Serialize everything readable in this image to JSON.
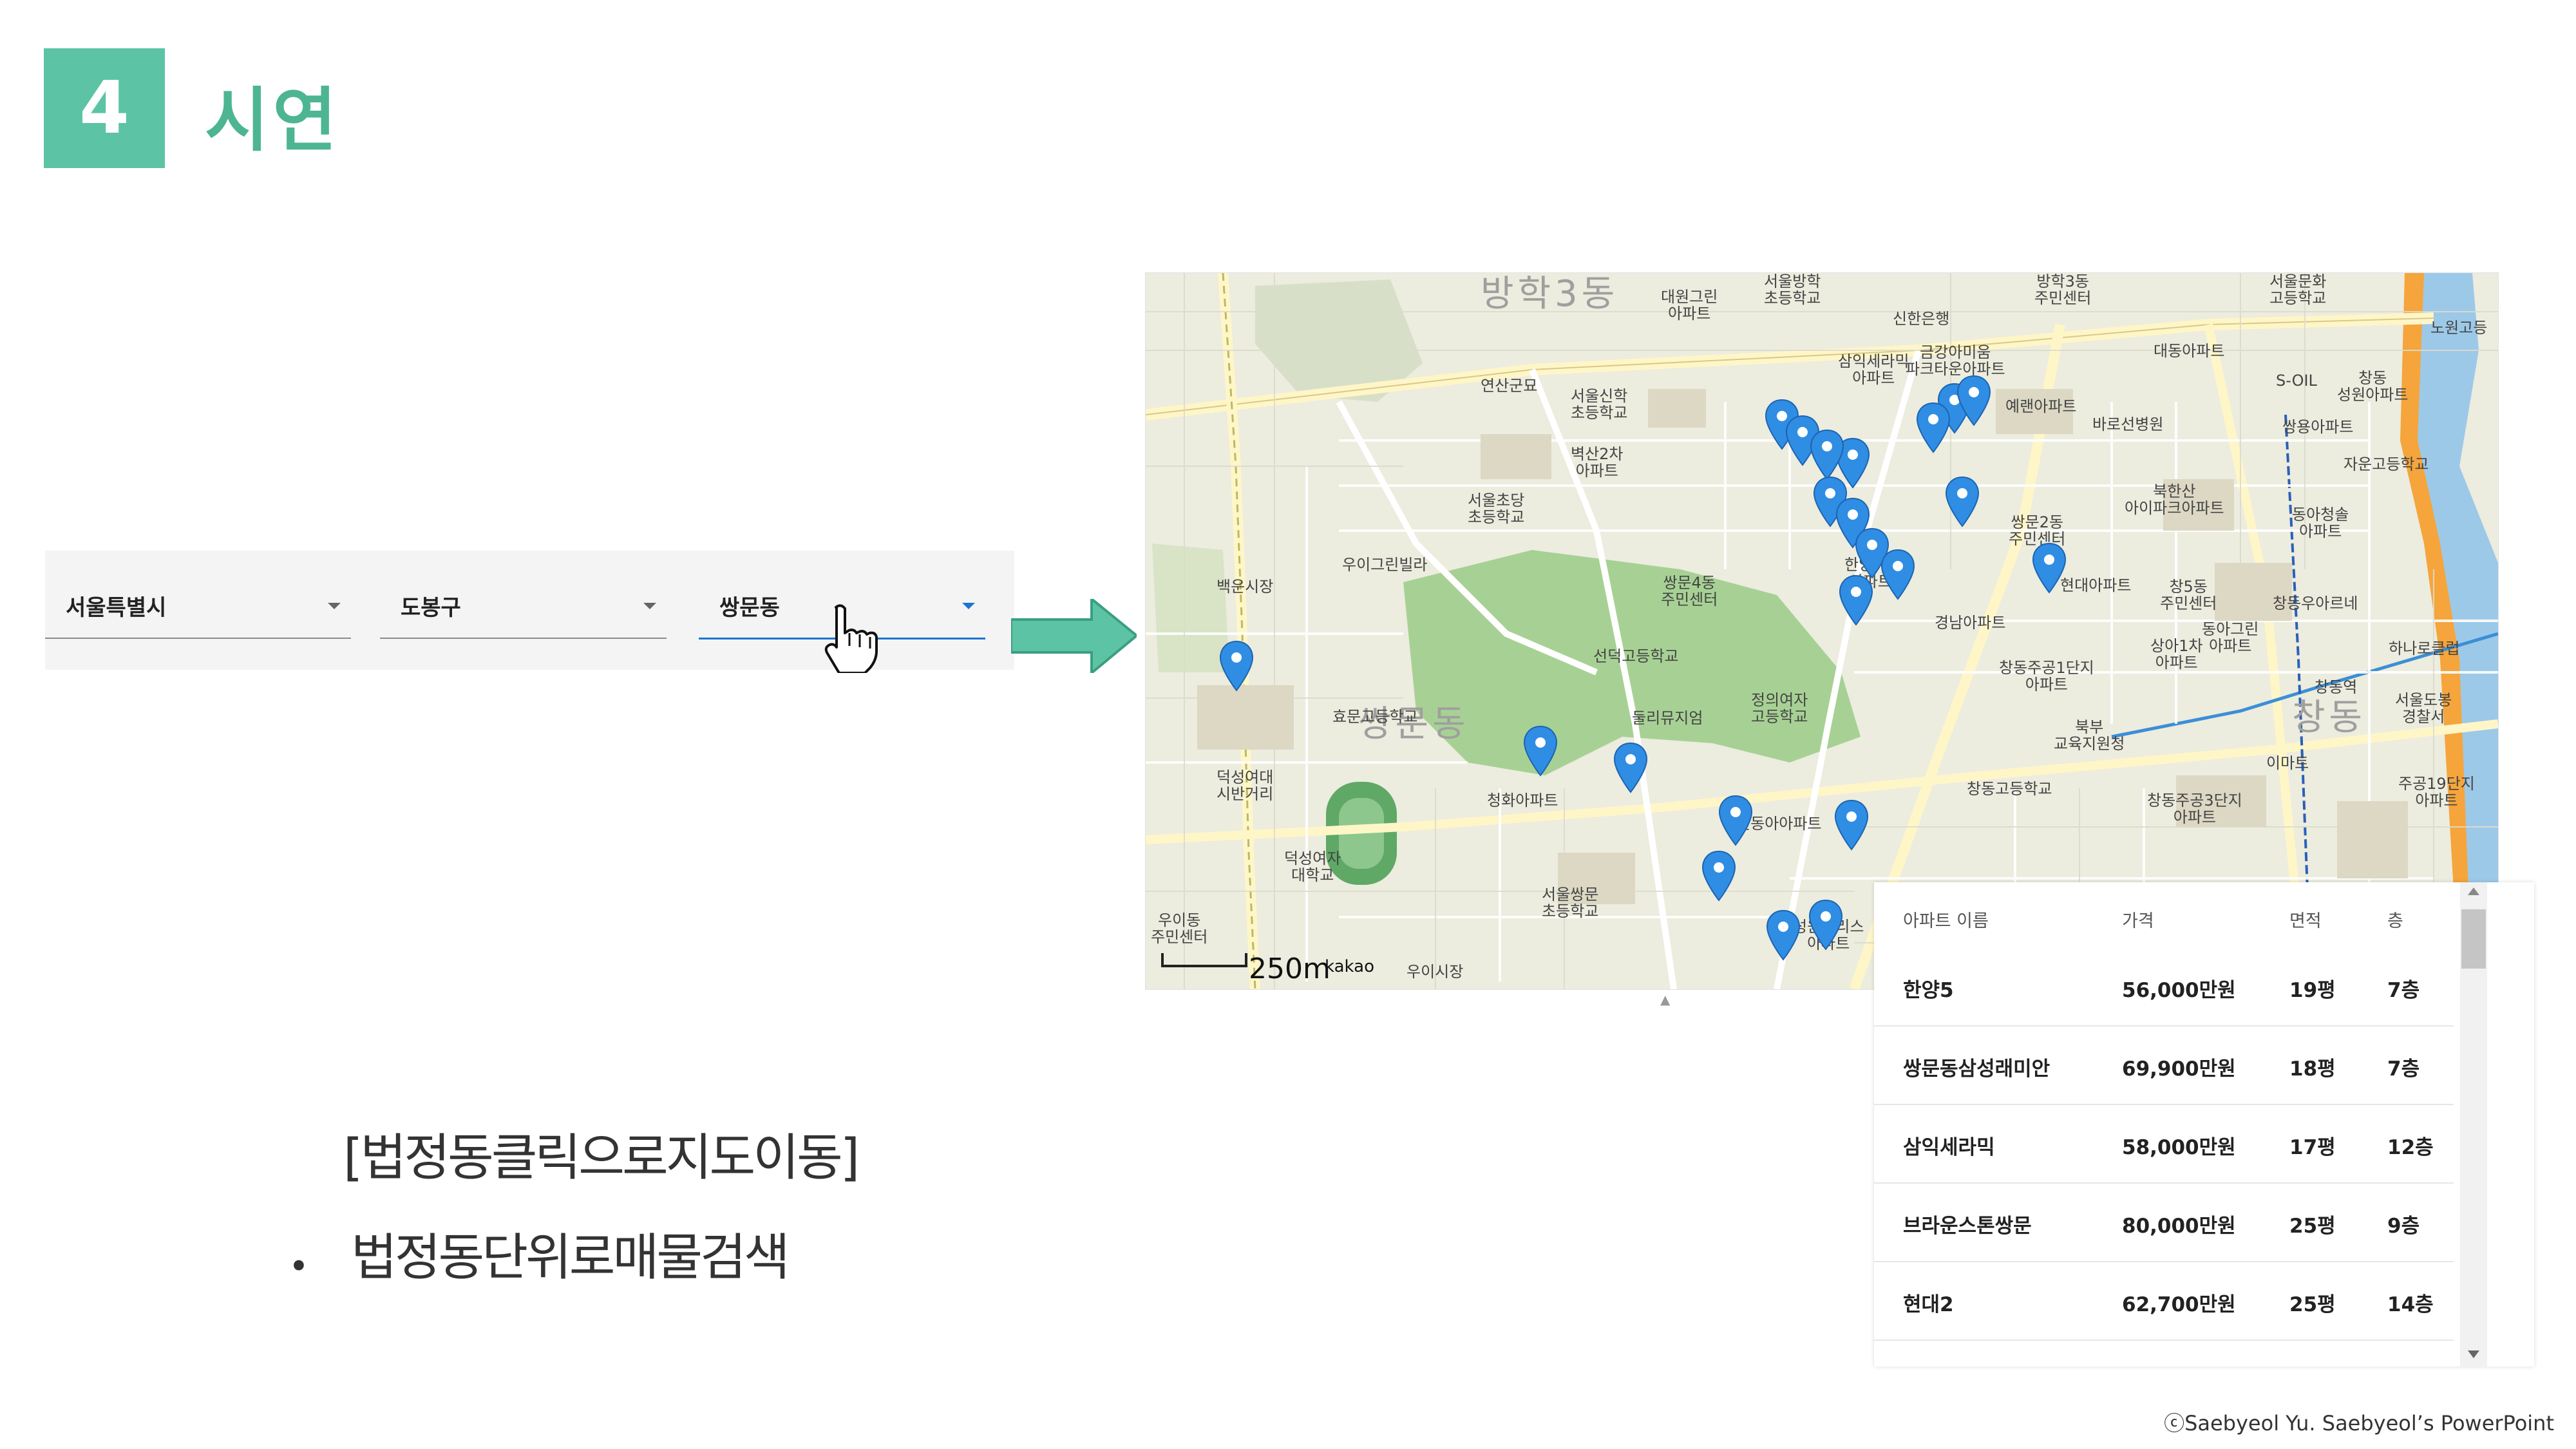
{
  "header": {
    "number": "4",
    "title": "시연"
  },
  "dropdowns": {
    "city": "서울특별시",
    "district": "도봉구",
    "dong": "쌍문동"
  },
  "map": {
    "area_labels": {
      "banghak3": "방학3동",
      "ssangmun": "쌍문동",
      "changdong": "창동"
    },
    "labels": [
      "대원그린\n아파트",
      "서울방학\n초등학교",
      "방학3동\n주민센터",
      "서울문화\n고등학교",
      "신한은행",
      "노원고등",
      "연산군묘",
      "서울신학\n초등학교",
      "삼익세라믹\n아파트",
      "금강아미움\n파크타운아파트",
      "예랜아파트",
      "대동아파트",
      "S-OIL",
      "창동\n성원아파트",
      "바로선병원",
      "쌍용아파트",
      "벽산2차\n아파트",
      "서울초당\n초등학교",
      "자운고등학교",
      "북한산\n아이파크아파트",
      "동아청솔\n아파트",
      "우이그린빌라",
      "쌍문4동\n주민센터",
      "쌍문2동\n주민센터",
      "창5동\n주민센터",
      "현대아파트",
      "창동우아르네",
      "백운시장",
      "경남아파트",
      "동아그린\n아파트",
      "하나로클럽",
      "덕성여대\n시반거리",
      "선덕고등학교",
      "창동주공1단지\n아파트",
      "상아1차\n아파트",
      "창동역",
      "서울도봉\n경찰서",
      "효문고등학교",
      "둘리뮤지엄",
      "정의여자\n고등학교",
      "북부\n교육지원청",
      "이마트",
      "청화아파트",
      "창동고등학교",
      "창동주공3단지\n아파트",
      "주공19단지\n아파트",
      "신동아아파트",
      "덕성여자\n대학교",
      "서울쌍문\n초등학교",
      "성원팰리스\n아파트",
      "우이동\n주민센터",
      "우이시장",
      "한양7차\n아파트"
    ],
    "scale": "250m",
    "brand": "kakao",
    "marker_color": "#2f8de4"
  },
  "table": {
    "headers": [
      "아파트 이름",
      "가격",
      "면적",
      "층"
    ],
    "rows": [
      [
        "한양5",
        "56,000만원",
        "19평",
        "7층"
      ],
      [
        "쌍문동삼성래미안",
        "69,900만원",
        "18평",
        "7층"
      ],
      [
        "삼익세라믹",
        "58,000만원",
        "17평",
        "12층"
      ],
      [
        "브라운스톤쌍문",
        "80,000만원",
        "25평",
        "9층"
      ],
      [
        "현대2",
        "62,700만원",
        "25평",
        "14층"
      ]
    ]
  },
  "caption": "[법정동클릭으로지도이동]",
  "bullet": {
    "dot": "•",
    "text": "법정동단위로매물검색"
  },
  "footer": "ⓒSaebyeol Yu. Saebyeol’s PowerPoint",
  "colors": {
    "accent": "#5cc4a4",
    "title": "#4db592",
    "select_active": "#1976d2"
  }
}
